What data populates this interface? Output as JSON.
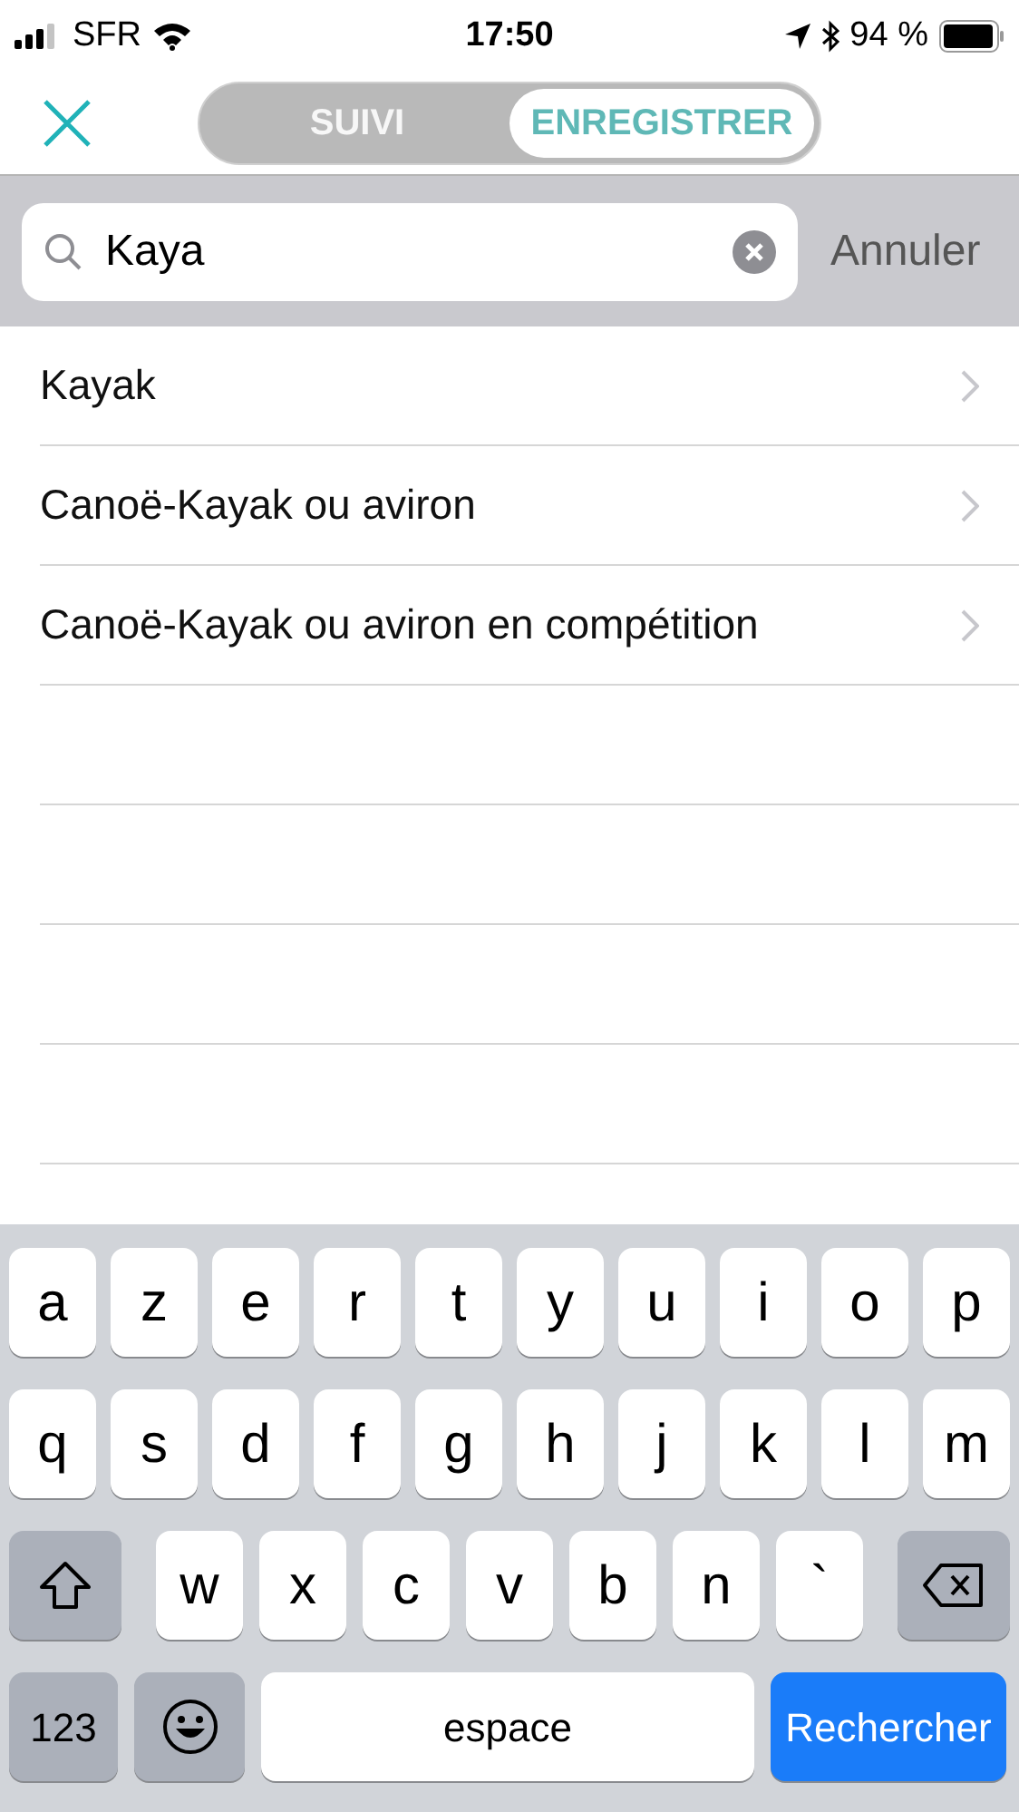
{
  "status_bar": {
    "carrier": "SFR",
    "time": "17:50",
    "battery": "94 %"
  },
  "tabs": [
    {
      "label": "SUIVI",
      "selected": false
    },
    {
      "label": "ENREGISTRER",
      "selected": true
    }
  ],
  "search": {
    "value": "Kaya",
    "cancel": "Annuler"
  },
  "results": [
    {
      "label": "Kayak"
    },
    {
      "label": "Canoë-Kayak ou aviron"
    },
    {
      "label": "Canoë-Kayak ou aviron en compétition"
    }
  ],
  "keyboard": {
    "rows": [
      {
        "keys": [
          {
            "kind": "letter",
            "label": "a"
          },
          {
            "kind": "letter",
            "label": "z"
          },
          {
            "kind": "letter",
            "label": "e"
          },
          {
            "kind": "letter",
            "label": "r"
          },
          {
            "kind": "letter",
            "label": "t"
          },
          {
            "kind": "letter",
            "label": "y"
          },
          {
            "kind": "letter",
            "label": "u"
          },
          {
            "kind": "letter",
            "label": "i"
          },
          {
            "kind": "letter",
            "label": "o"
          },
          {
            "kind": "letter",
            "label": "p"
          }
        ]
      },
      {
        "keys": [
          {
            "kind": "letter",
            "label": "q"
          },
          {
            "kind": "letter",
            "label": "s"
          },
          {
            "kind": "letter",
            "label": "d"
          },
          {
            "kind": "letter",
            "label": "f"
          },
          {
            "kind": "letter",
            "label": "g"
          },
          {
            "kind": "letter",
            "label": "h"
          },
          {
            "kind": "letter",
            "label": "j"
          },
          {
            "kind": "letter",
            "label": "k"
          },
          {
            "kind": "letter",
            "label": "l"
          },
          {
            "kind": "letter",
            "label": "m"
          }
        ]
      },
      {
        "keys": [
          {
            "kind": "shift"
          },
          {
            "kind": "letter",
            "label": "w"
          },
          {
            "kind": "letter",
            "label": "x"
          },
          {
            "kind": "letter",
            "label": "c"
          },
          {
            "kind": "letter",
            "label": "v"
          },
          {
            "kind": "letter",
            "label": "b"
          },
          {
            "kind": "letter",
            "label": "n"
          },
          {
            "kind": "letter",
            "label": "`"
          },
          {
            "kind": "delete"
          }
        ]
      },
      {
        "keys": [
          {
            "kind": "numbers",
            "label": "123"
          },
          {
            "kind": "emoji"
          },
          {
            "kind": "space",
            "label": "espace"
          },
          {
            "kind": "action",
            "label": "Rechercher"
          }
        ]
      }
    ]
  }
}
